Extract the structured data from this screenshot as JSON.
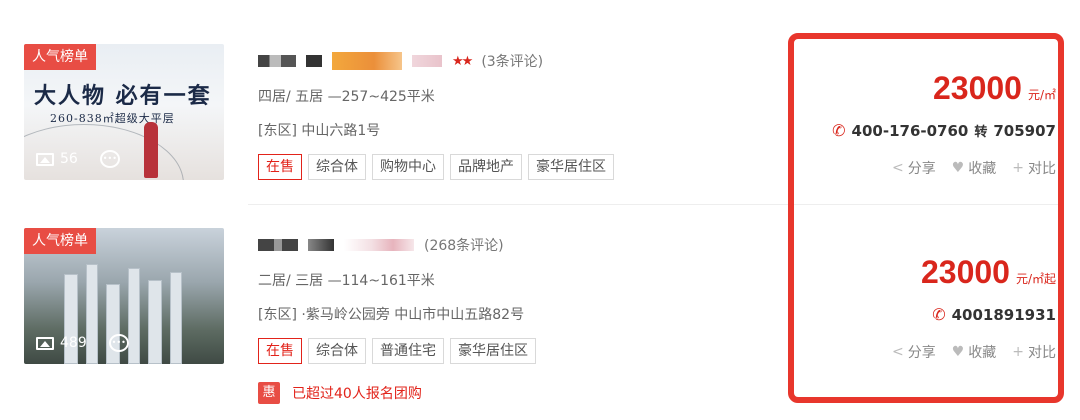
{
  "listings": [
    {
      "rank_badge": "人气榜单",
      "ad_headline": "大人物 必有一套",
      "ad_subline": "260-838㎡超级大平层",
      "photo_count": "56",
      "reviews": "(3条评论)",
      "layout": "四居/ 五居 —257~425平米",
      "address": "[东区] 中山六路1号",
      "tags": [
        "在售",
        "综合体",
        "购物中心",
        "品牌地产",
        "豪华居住区"
      ],
      "price": "23000",
      "price_unit": "元/㎡",
      "phone": "400-176-0760",
      "ext_label": "转",
      "ext": "705907",
      "actions": [
        "分享",
        "收藏",
        "对比"
      ]
    },
    {
      "rank_badge": "人气榜单",
      "photo_count": "489",
      "reviews": "(268条评论)",
      "layout": "二居/ 三居 —114~161平米",
      "address": "[东区] ·紫马岭公园旁 中山市中山五路82号",
      "tags": [
        "在售",
        "综合体",
        "普通住宅",
        "豪华居住区"
      ],
      "promo_badge": "惠",
      "promo_text": "已超过40人报名团购",
      "price": "23000",
      "price_unit": "元/㎡起",
      "phone": "4001891931",
      "actions": [
        "分享",
        "收藏",
        "对比"
      ]
    }
  ],
  "colors": {
    "accent": "#d9261c",
    "badge": "#e84d44",
    "highlight_border": "#e8362c"
  },
  "icons": [
    "photo-icon",
    "chat-icon",
    "phone-icon",
    "share-icon",
    "heart-icon",
    "plus-icon",
    "star-icon"
  ]
}
